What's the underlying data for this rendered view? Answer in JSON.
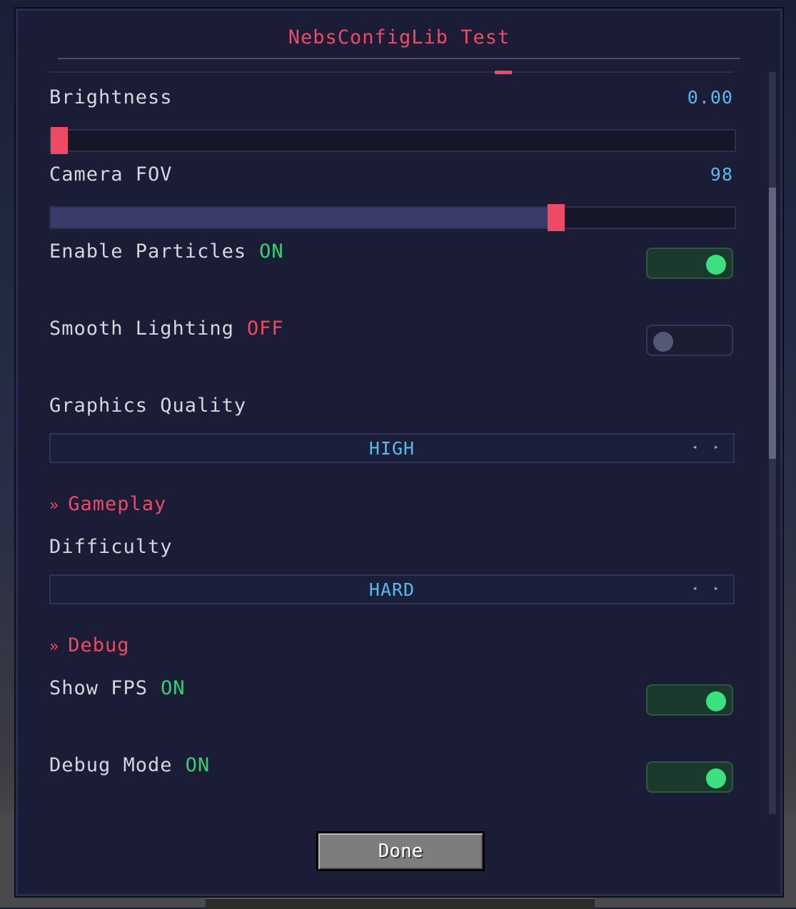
{
  "title": "NebsConfigLib Test",
  "settings": {
    "brightness": {
      "label": "Brightness",
      "value": "0.00",
      "fraction": 0.0
    },
    "camera_fov": {
      "label": "Camera FOV",
      "value": "98",
      "fraction": 0.745
    },
    "particles": {
      "label": "Enable Particles",
      "state": "ON",
      "enabled": true
    },
    "smooth_lighting": {
      "label": "Smooth Lighting",
      "state": "OFF",
      "enabled": false
    },
    "graphics": {
      "label": "Graphics Quality",
      "value": "HIGH"
    }
  },
  "sections": {
    "gameplay": {
      "chevron": "»",
      "label": "Gameplay"
    },
    "debug": {
      "chevron": "»",
      "label": "Debug"
    }
  },
  "gameplay": {
    "difficulty": {
      "label": "Difficulty",
      "value": "HARD"
    }
  },
  "debug": {
    "show_fps": {
      "label": "Show FPS",
      "state": "ON",
      "enabled": true
    },
    "debug_mode": {
      "label": "Debug Mode",
      "state": "ON",
      "enabled": true
    }
  },
  "cycle_arrows": "◂ ▸",
  "done_label": "Done",
  "colors": {
    "accent": "#ee4a66",
    "on": "#37cf74",
    "off": "#ee4a5a",
    "value": "#5ab9ef"
  }
}
